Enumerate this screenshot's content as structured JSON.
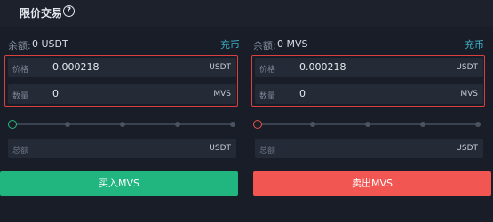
{
  "header": {
    "title": "限价交易",
    "help_icon": "?"
  },
  "buy": {
    "balance_label": "余额:",
    "balance_value": "0 USDT",
    "deposit_label": "充币",
    "price": {
      "label": "价格",
      "value": "0.000218",
      "unit": "USDT"
    },
    "amount": {
      "label": "数量",
      "value": "0",
      "unit": "MVS"
    },
    "slider_percent": 0,
    "total": {
      "label": "总额",
      "unit": "USDT"
    },
    "button_label": "买入MVS"
  },
  "sell": {
    "balance_label": "余额:",
    "balance_value": "0 MVS",
    "deposit_label": "充币",
    "price": {
      "label": "价格",
      "value": "0.000218",
      "unit": "USDT"
    },
    "amount": {
      "label": "数量",
      "value": "0",
      "unit": "MVS"
    },
    "slider_percent": 0,
    "total": {
      "label": "总额",
      "unit": "USDT"
    },
    "button_label": "卖出MVS"
  },
  "colors": {
    "buy": "#21b57f",
    "sell": "#f25652",
    "link": "#3eb2c9",
    "highlight": "#d9403e",
    "background": "#181d27"
  }
}
